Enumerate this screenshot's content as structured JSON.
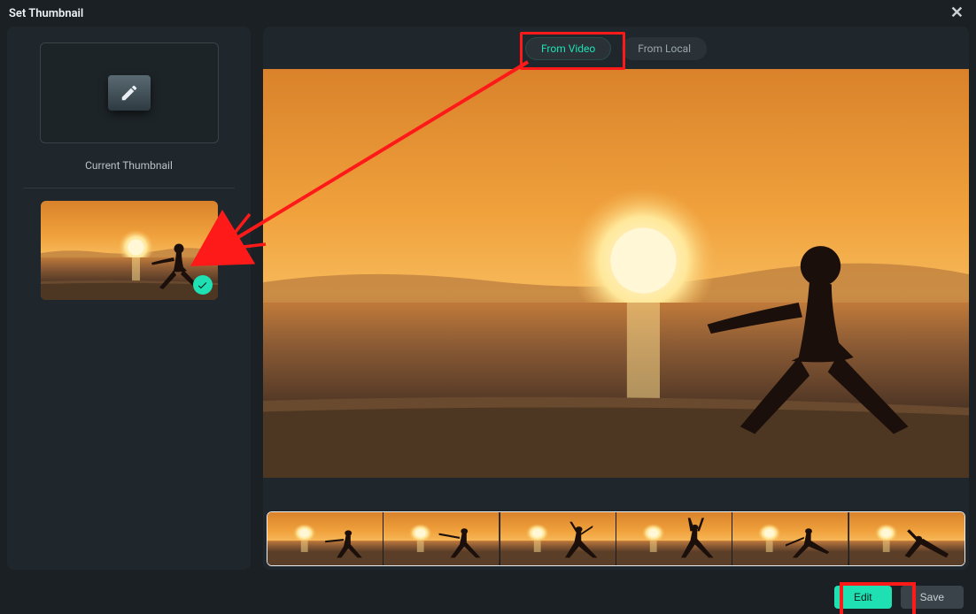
{
  "dialog": {
    "title": "Set Thumbnail"
  },
  "left": {
    "current_label": "Current Thumbnail",
    "icons": {
      "pencil": "pencil-icon",
      "check": "check-icon"
    }
  },
  "tabs": {
    "from_video": "From Video",
    "from_local": "From Local",
    "active": "from_video"
  },
  "timeline": {
    "frame_count": 6
  },
  "buttons": {
    "edit": "Edit",
    "save": "Save",
    "close": "✕"
  },
  "colors": {
    "accent": "#1fe0b3",
    "panel": "#20272c",
    "bg": "#1a2024",
    "annotation": "#ff1a1a",
    "playhead": "#ff3355"
  }
}
